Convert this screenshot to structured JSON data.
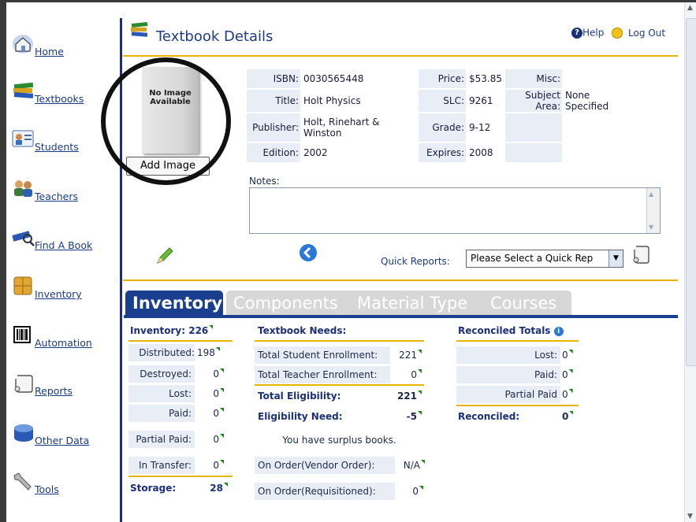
{
  "nav": [
    {
      "label": "Home",
      "icon": "home-icon"
    },
    {
      "label": "Textbooks",
      "icon": "books-icon"
    },
    {
      "label": "Students",
      "icon": "students-icon"
    },
    {
      "label": "Teachers",
      "icon": "teachers-icon"
    },
    {
      "label": "Find A Book",
      "icon": "find-book-icon"
    },
    {
      "label": "Inventory",
      "icon": "inventory-box-icon"
    },
    {
      "label": "Automation",
      "icon": "barcode-icon"
    },
    {
      "label": "Reports",
      "icon": "scroll-icon"
    },
    {
      "label": "Other Data",
      "icon": "database-icon"
    },
    {
      "label": "Tools",
      "icon": "wrench-icon"
    }
  ],
  "header": {
    "title": "Textbook Details",
    "help": "Help",
    "logout": "Log Out"
  },
  "image": {
    "placeholder": "No Image Available",
    "add_button": "Add Image"
  },
  "details": {
    "isbn_label": "ISBN:",
    "isbn": "0030565448",
    "title_label": "Title:",
    "title": "Holt Physics",
    "publisher_label": "Publisher:",
    "publisher": "Holt, Rinehart & Winston",
    "edition_label": "Edition:",
    "edition": "2002",
    "price_label": "Price:",
    "price": "$53.85",
    "slc_label": "SLC:",
    "slc": "9261",
    "grade_label": "Grade:",
    "grade": "9-12",
    "expires_label": "Expires:",
    "expires": "2008",
    "misc_label": "Misc:",
    "subject_label": "Subject Area:",
    "subject": "None Specified"
  },
  "notes": {
    "label": "Notes:",
    "value": ""
  },
  "quick_reports": {
    "label": "Quick Reports:",
    "selected": "Please Select a Quick Rep"
  },
  "tabs": [
    "Inventory",
    "Components",
    "Material Type",
    "Courses"
  ],
  "inventory": {
    "header_label": "Inventory:",
    "header_value": "226",
    "rows": [
      {
        "label": "Distributed:",
        "value": "198"
      },
      {
        "label": "Destroyed:",
        "value": "0"
      },
      {
        "label": "Lost:",
        "value": "0"
      },
      {
        "label": "Paid:",
        "value": "0"
      },
      {
        "label": "Partial Paid:",
        "value": "0"
      },
      {
        "label": "In Transfer:",
        "value": "0"
      }
    ],
    "storage_label": "Storage:",
    "storage_value": "28"
  },
  "needs": {
    "header": "Textbook Needs:",
    "student_label": "Total Student Enrollment:",
    "student_value": "221",
    "teacher_label": "Total Teacher Enrollment:",
    "teacher_value": "0",
    "elig_label": "Total Eligibility:",
    "elig_value": "221",
    "need_label": "Eligibility Need:",
    "need_value": "-5",
    "surplus": "You have surplus books.",
    "vendor_label": "On Order(Vendor Order):",
    "vendor_value": "N/A",
    "req_label": "On Order(Requisitioned):",
    "req_value": "0"
  },
  "reconciled": {
    "header": "Reconciled Totals",
    "lost_label": "Lost:",
    "lost_value": "0",
    "paid_label": "Paid:",
    "paid_value": "0",
    "partial_label": "Partial Paid",
    "partial_value": "0",
    "rec_label": "Reconciled:",
    "rec_value": "0"
  },
  "colors": {
    "accent": "#1b3f8f",
    "gold": "#e7b400",
    "link": "#1a3a8a"
  }
}
